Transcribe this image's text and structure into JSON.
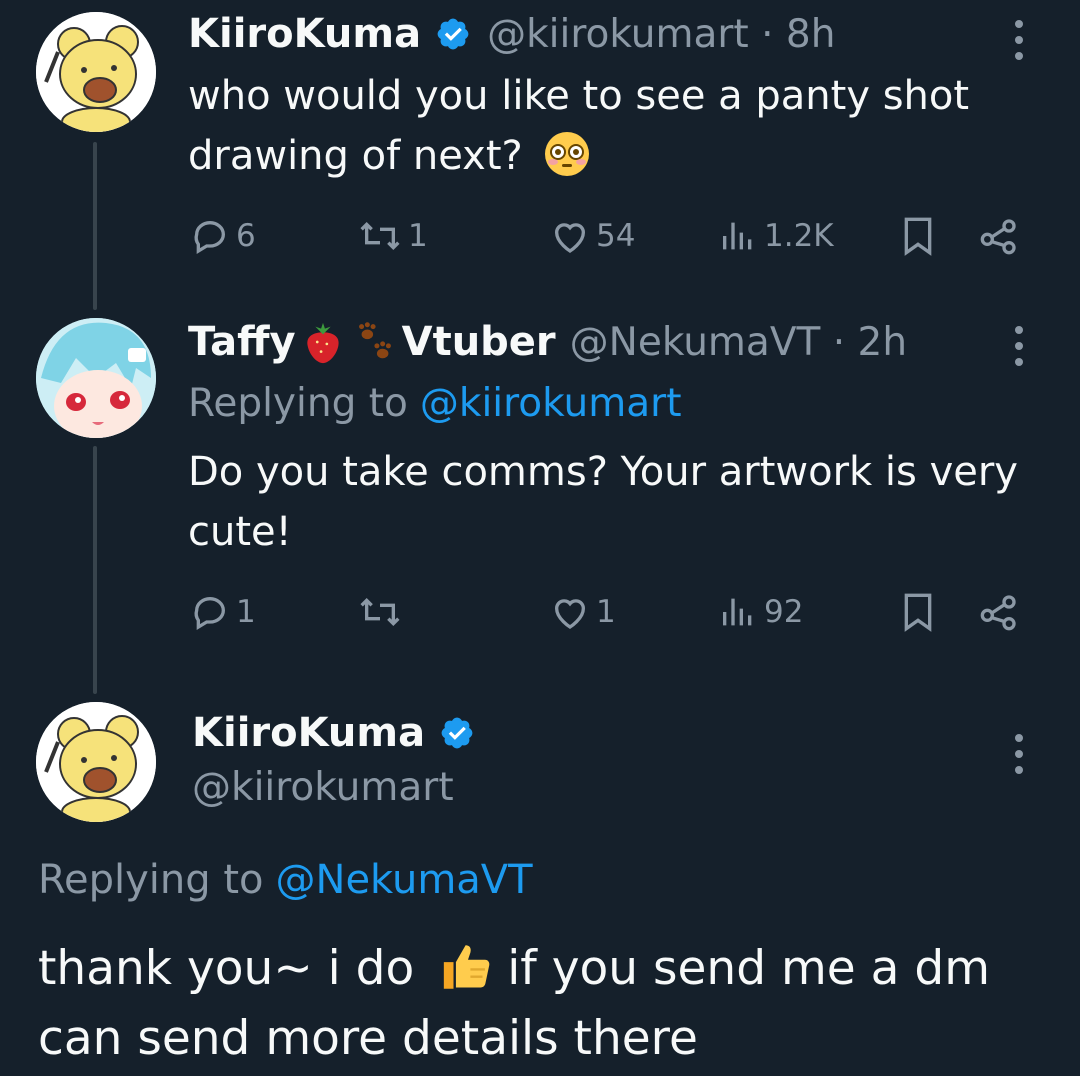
{
  "colors": {
    "background": "#15202b",
    "text": "#f7f9f9",
    "muted": "#8b98a5",
    "link": "#1d9bf0",
    "verified": "#1d9bf0"
  },
  "tweet1": {
    "author_name": "KiiroKuma",
    "handle_time": "@kiirokumart · 8h",
    "text_line1": "who would you like to see a panty shot",
    "text_line2": "drawing of next?",
    "emoji": "flushed-face",
    "replies": "6",
    "retweets": "1",
    "likes": "54",
    "views": "1.2K"
  },
  "tweet2": {
    "author_name_part1": "Taffy",
    "author_name_part2": "Vtuber",
    "name_emojis": [
      "strawberry",
      "paw-prints"
    ],
    "handle_time": "@NekumaVT · 2h",
    "replying_prefix": "Replying to",
    "replying_to": "@kiirokumart",
    "text_line1": "Do you take comms? Your artwork is very",
    "text_line2": "cute!",
    "replies": "1",
    "retweets": "",
    "likes": "1",
    "views": "92"
  },
  "tweet3": {
    "author_name": "KiiroKuma",
    "handle": "@kiirokumart",
    "replying_prefix": "Replying to",
    "replying_to": "@NekumaVT",
    "text_part1": "thank you~ i do",
    "emoji": "thumbs-up",
    "text_part2": "if you send me a dm",
    "text_line2": "can send more details there"
  }
}
